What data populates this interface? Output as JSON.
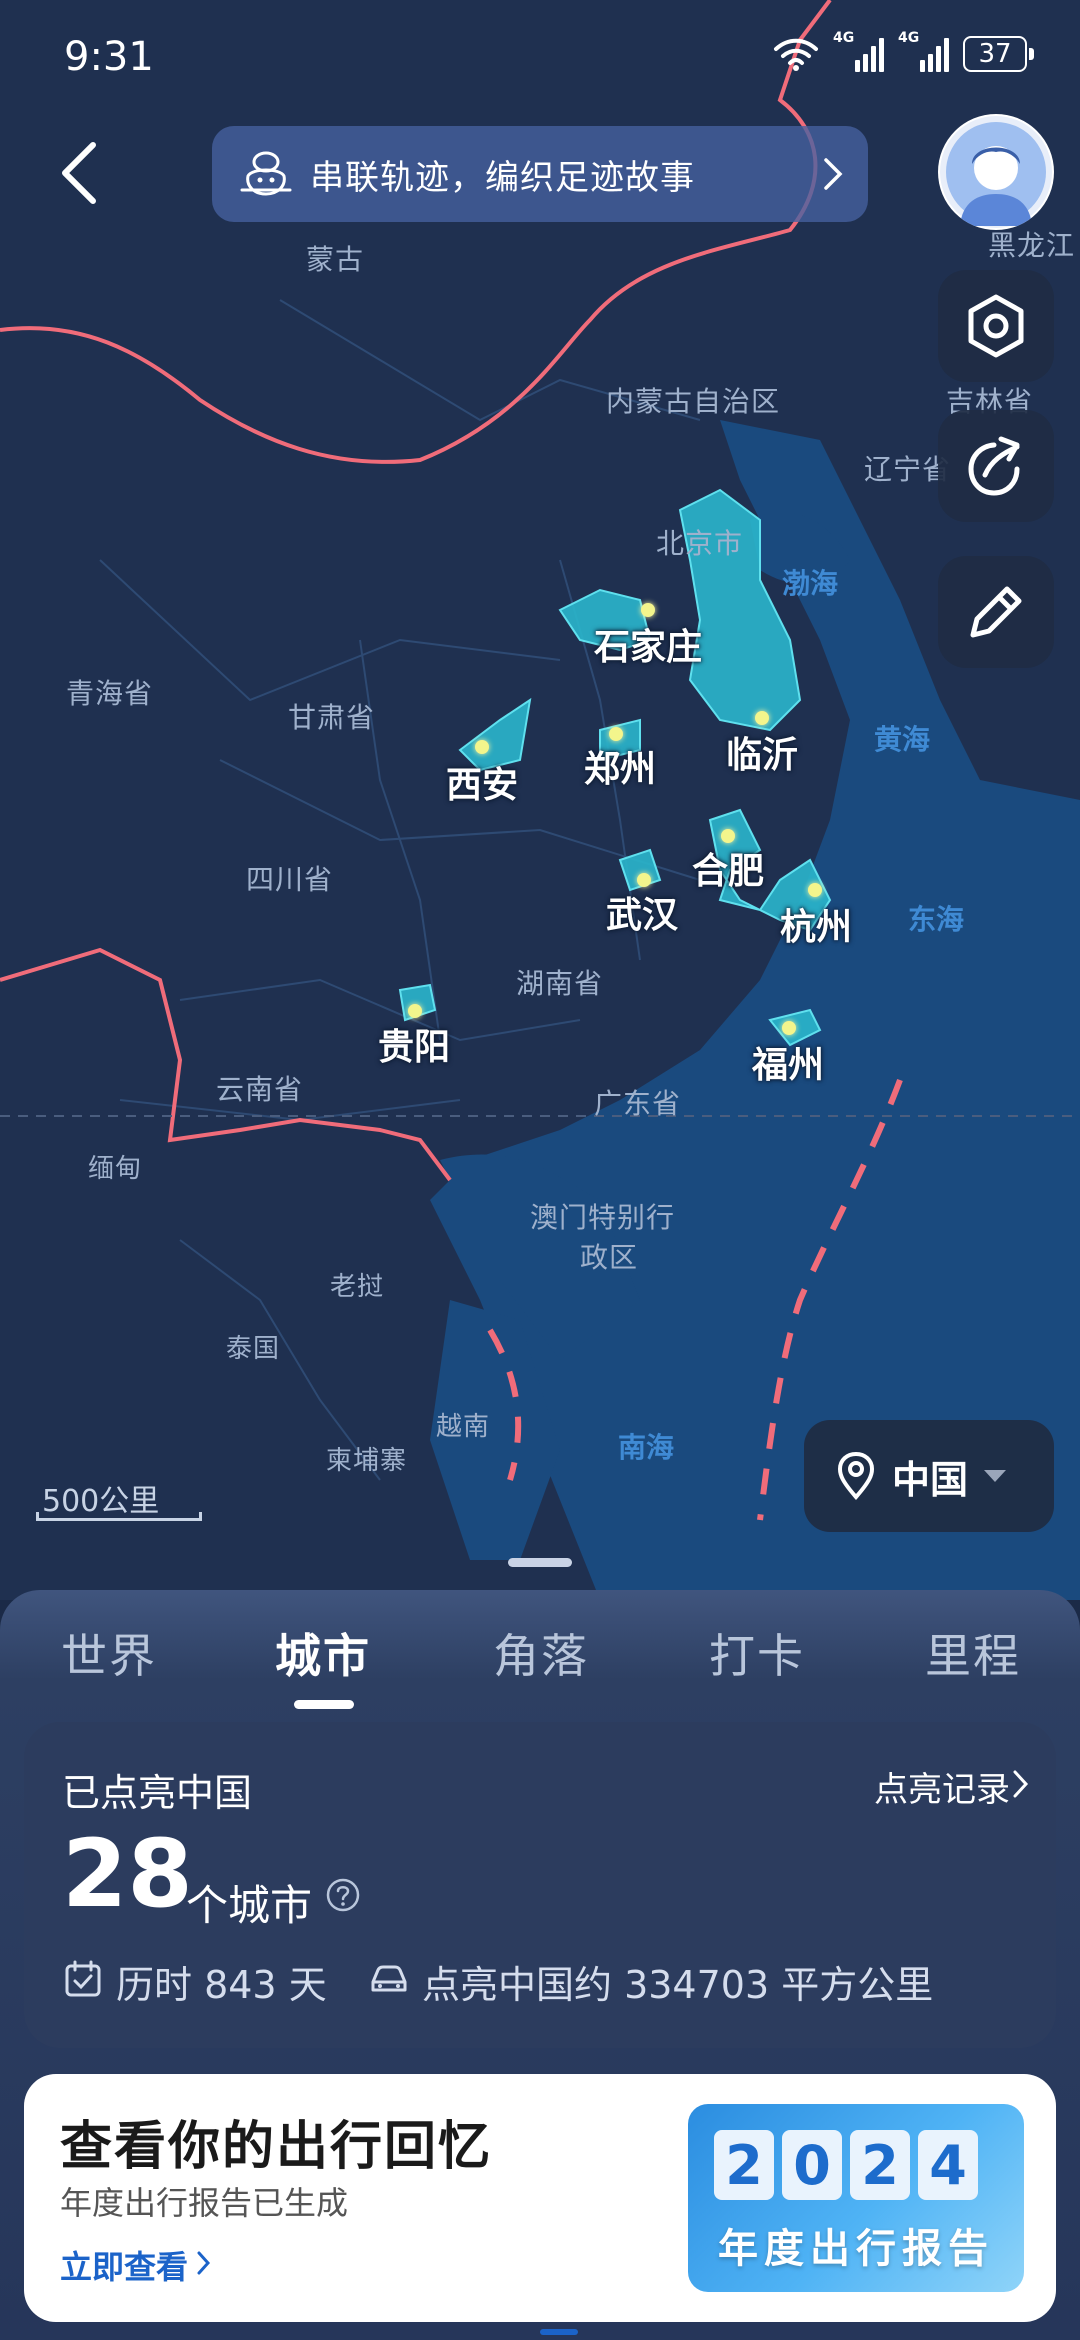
{
  "status_bar": {
    "time": "9:31",
    "signal_tag_1": "4G",
    "signal_tag_2": "4G",
    "battery": "37"
  },
  "header": {
    "banner_text": "串联轨迹，编织足迹故事"
  },
  "map": {
    "region_labels": [
      "蒙古",
      "内蒙古自治区",
      "黑龙江",
      "吉林省",
      "辽宁省",
      "青海省",
      "甘肃省",
      "四川省",
      "湖南省",
      "云南省",
      "广东省",
      "澳门特别行",
      "政区",
      "缅甸",
      "老挝",
      "泰国",
      "越南",
      "柬埔寨",
      "北京市"
    ],
    "sea_labels": [
      "渤海",
      "黄海",
      "东海",
      "南海"
    ],
    "cities": [
      "石家庄",
      "临沂",
      "西安",
      "郑州",
      "合肥",
      "武汉",
      "杭州",
      "贵阳",
      "福州"
    ],
    "scale": "500公里",
    "region_select": "中国",
    "colors": {
      "lit_region": "#2ab6cc",
      "border": "#f06c7a",
      "land": "#223555",
      "sea": "#1a4a82"
    }
  },
  "tabs": [
    {
      "label": "世界",
      "active": false
    },
    {
      "label": "城市",
      "active": true
    },
    {
      "label": "角落",
      "active": false
    },
    {
      "label": "打卡",
      "active": false
    },
    {
      "label": "里程",
      "active": false
    }
  ],
  "stats": {
    "title": "已点亮中国",
    "record_link": "点亮记录",
    "count": "28",
    "count_unit": "个城市",
    "days": "历时 843 天",
    "area": "点亮中国约 334703 平方公里"
  },
  "report": {
    "title": "查看你的出行回忆",
    "subtitle": "年度出行报告已生成",
    "link": "立即查看",
    "year_digits": [
      "2",
      "0",
      "2",
      "4"
    ],
    "badge_label": "年度出行报告"
  },
  "icons": {
    "back": "back-arrow-icon",
    "banner": "footprint-mascot-icon",
    "settings": "hexagon-settings-icon",
    "share": "share-icon",
    "edit": "pencil-icon",
    "location": "location-pin-icon",
    "help": "question-icon",
    "calendar": "calendar-check-icon",
    "car": "car-icon"
  }
}
